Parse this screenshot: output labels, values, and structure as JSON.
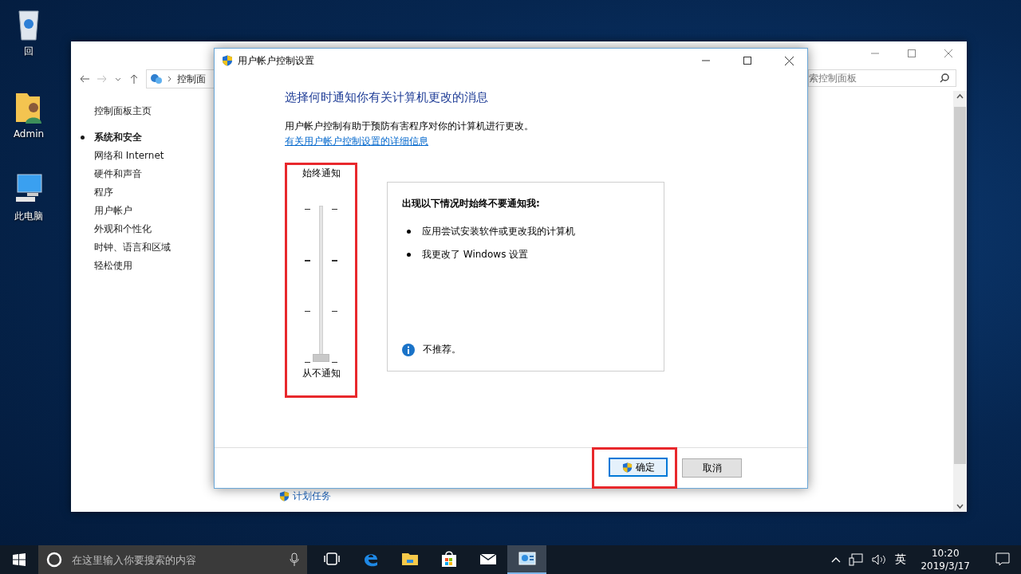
{
  "desktop_icons": [
    {
      "kind": "recycle",
      "label": "回"
    },
    {
      "kind": "user",
      "label": "Admin"
    },
    {
      "kind": "computer",
      "label": "此电脑"
    }
  ],
  "control_panel": {
    "address": "控制面",
    "search": {
      "placeholder": "索控制面板"
    },
    "sidebar": {
      "home": "控制面板主页",
      "items": [
        {
          "label": "系统和安全",
          "selected": true
        },
        {
          "label": "网络和 Internet",
          "selected": false
        },
        {
          "label": "硬件和声音",
          "selected": false
        },
        {
          "label": "程序",
          "selected": false
        },
        {
          "label": "用户帐户",
          "selected": false
        },
        {
          "label": "外观和个性化",
          "selected": false
        },
        {
          "label": "时钟、语言和区域",
          "selected": false
        },
        {
          "label": "轻松使用",
          "selected": false
        }
      ]
    },
    "bottom_link": "计划任务"
  },
  "dialog": {
    "title": "用户帐户控制设置",
    "heading": "选择何时通知你有关计算机更改的消息",
    "description": "用户帐户控制有助于预防有害程序对你的计算机进行更改。",
    "link": "有关用户帐户控制设置的详细信息",
    "slider": {
      "top_label": "始终通知",
      "bottom_label": "从不通知",
      "level": 0
    },
    "info": {
      "title": "出现以下情况时始终不要通知我:",
      "bullets": [
        "应用尝试安装软件或更改我的计算机",
        "我更改了 Windows 设置"
      ],
      "note": "不推荐。"
    },
    "buttons": [
      {
        "label": "确定",
        "kind": "primary"
      },
      {
        "label": "取消",
        "kind": "secondary"
      }
    ]
  },
  "taskbar": {
    "search": {
      "placeholder": "在这里输入你要搜索的内容"
    },
    "apps": [
      {
        "kind": "taskview",
        "active": false
      },
      {
        "kind": "edge",
        "active": false
      },
      {
        "kind": "explorer",
        "active": false
      },
      {
        "kind": "store",
        "active": false
      },
      {
        "kind": "mail",
        "active": false
      },
      {
        "kind": "controlpanel",
        "active": true
      }
    ],
    "ime": "英",
    "time": "10:20",
    "date": "2019/3/17"
  }
}
